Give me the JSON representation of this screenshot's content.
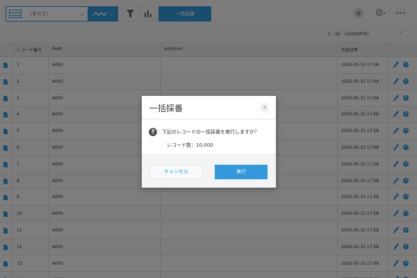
{
  "toolbar": {
    "view_label": "（すべて）",
    "bulk_button_label": "一括採番",
    "icons": [
      "grid-icon",
      "chevron-down-icon",
      "graph-icon",
      "filter-icon",
      "chart-icon",
      "plus-icon",
      "gear-icon",
      "more-icon"
    ]
  },
  "pager": {
    "range": "1 - 20 （10000件中）"
  },
  "table": {
    "headers": {
      "record_no": "レコード番号",
      "field": "Field",
      "autonum": "autonum",
      "created": "作成日時"
    },
    "rows": [
      {
        "id": "1",
        "field": "A000",
        "created": "2026-05-15 17:08"
      },
      {
        "id": "2",
        "field": "A000",
        "created": "2026-05-15 17:08"
      },
      {
        "id": "3",
        "field": "A000",
        "created": "2026-05-15 17:08"
      },
      {
        "id": "4",
        "field": "A000",
        "created": "2026-05-15 17:08"
      },
      {
        "id": "5",
        "field": "A000",
        "created": "2026-05-15 17:08"
      },
      {
        "id": "6",
        "field": "A000",
        "created": "2026-05-15 17:08"
      },
      {
        "id": "7",
        "field": "A000",
        "created": "2026-05-15 17:08"
      },
      {
        "id": "8",
        "field": "A000",
        "created": "2026-05-15 17:08"
      },
      {
        "id": "9",
        "field": "A000",
        "created": "2026-05-15 17:08"
      },
      {
        "id": "10",
        "field": "A000",
        "created": "2026-05-15 17:08"
      },
      {
        "id": "11",
        "field": "A000",
        "created": "2026-05-15 17:08"
      },
      {
        "id": "12",
        "field": "A000",
        "created": "2026-05-15 17:08"
      },
      {
        "id": "13",
        "field": "A000",
        "created": "2026-05-15 17:08"
      },
      {
        "id": "14",
        "field": "A000",
        "created": "2026-05-15 17:08"
      }
    ]
  },
  "dialog": {
    "title": "一括採番",
    "message": "下記のレコードの一括採番を実行しますか？",
    "count_label": "レコード数：",
    "count_value": "10,000",
    "cancel_label": "キャンセル",
    "execute_label": "実行"
  },
  "colors": {
    "accent": "#3498db",
    "overlay": "rgba(0,0,0,0.5)"
  }
}
